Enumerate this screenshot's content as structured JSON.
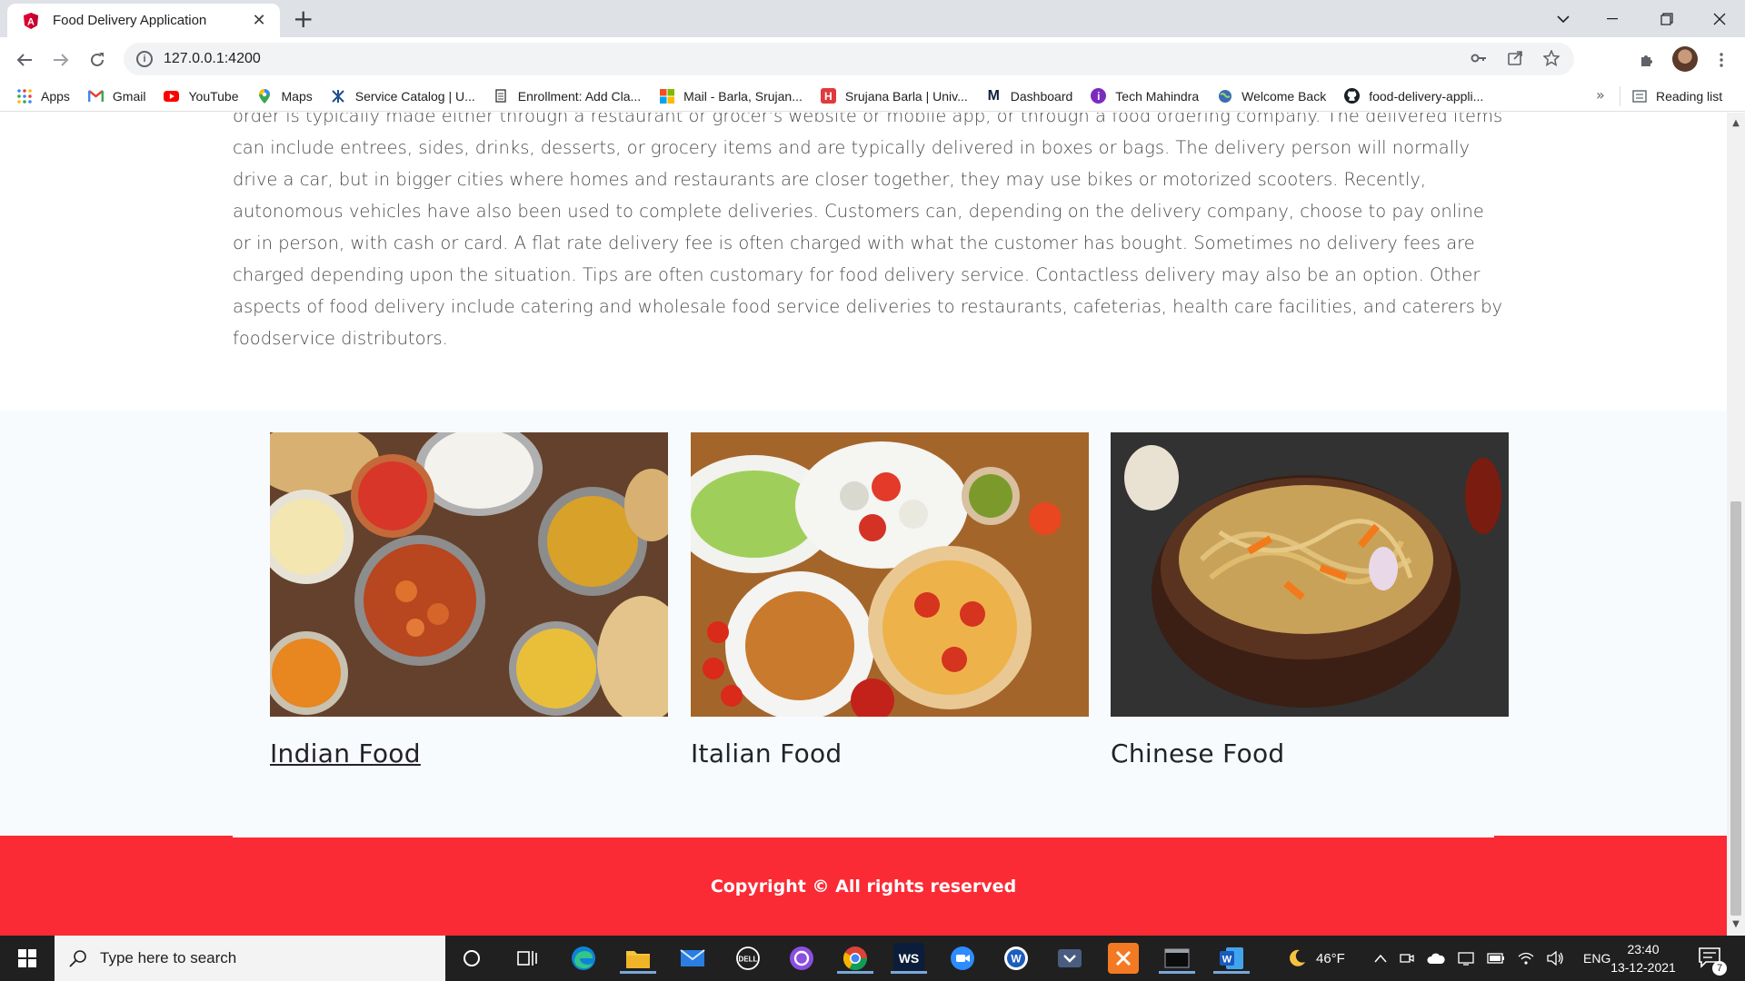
{
  "browser": {
    "tab_title": "Food Delivery Application",
    "url": "127.0.0.1:4200",
    "bookmarks": [
      {
        "label": "Apps",
        "icon": "apps-grid-icon"
      },
      {
        "label": "Gmail",
        "icon": "gmail-icon"
      },
      {
        "label": "YouTube",
        "icon": "youtube-icon"
      },
      {
        "label": "Maps",
        "icon": "maps-pin-icon"
      },
      {
        "label": "Service Catalog | U...",
        "icon": "service-catalog-icon"
      },
      {
        "label": "Enrollment: Add Cla...",
        "icon": "document-icon"
      },
      {
        "label": "Mail - Barla, Srujan...",
        "icon": "microsoft-icon"
      },
      {
        "label": "Srujana Barla | Univ...",
        "icon": "university-icon"
      },
      {
        "label": "Dashboard",
        "icon": "dashboard-m-icon"
      },
      {
        "label": "Tech Mahindra",
        "icon": "tech-mahindra-icon"
      },
      {
        "label": "Welcome Back",
        "icon": "globe-icon"
      },
      {
        "label": "food-delivery-appli...",
        "icon": "github-icon"
      }
    ],
    "bookmarks_overflow": "»",
    "reading_list": "Reading list"
  },
  "page": {
    "about_text": "order is typically made either through a restaurant or grocer's website or mobile app, or through a food ordering company. The delivered items can include entrees, sides, drinks, desserts, or grocery items and are typically delivered in boxes or bags. The delivery person will normally drive a car, but in bigger cities where homes and restaurants are closer together, they may use bikes or motorized scooters. Recently, autonomous vehicles have also been used to complete deliveries. Customers can, depending on the delivery company, choose to pay online or in person, with cash or card. A flat rate delivery fee is often charged with what the customer has bought. Sometimes no delivery fees are charged depending upon the situation. Tips are often customary for food delivery service. Contactless delivery may also be an option. Other aspects of food delivery include catering and wholesale food service deliveries to restaurants, cafeterias, health care facilities, and caterers by foodservice distributors.",
    "cards": [
      {
        "title": "Indian Food"
      },
      {
        "title": "Italian Food"
      },
      {
        "title": "Chinese Food"
      }
    ],
    "footer_text": "Copyright © All rights reserved"
  },
  "taskbar": {
    "search_placeholder": "Type here to search",
    "weather": "46°F",
    "language": "ENG",
    "time": "23:40",
    "date": "13-12-2021",
    "notification_count": "7"
  },
  "colors": {
    "footer": "#fb2b35",
    "section_bg": "#f7fbfd",
    "text": "#4a4a4a"
  }
}
